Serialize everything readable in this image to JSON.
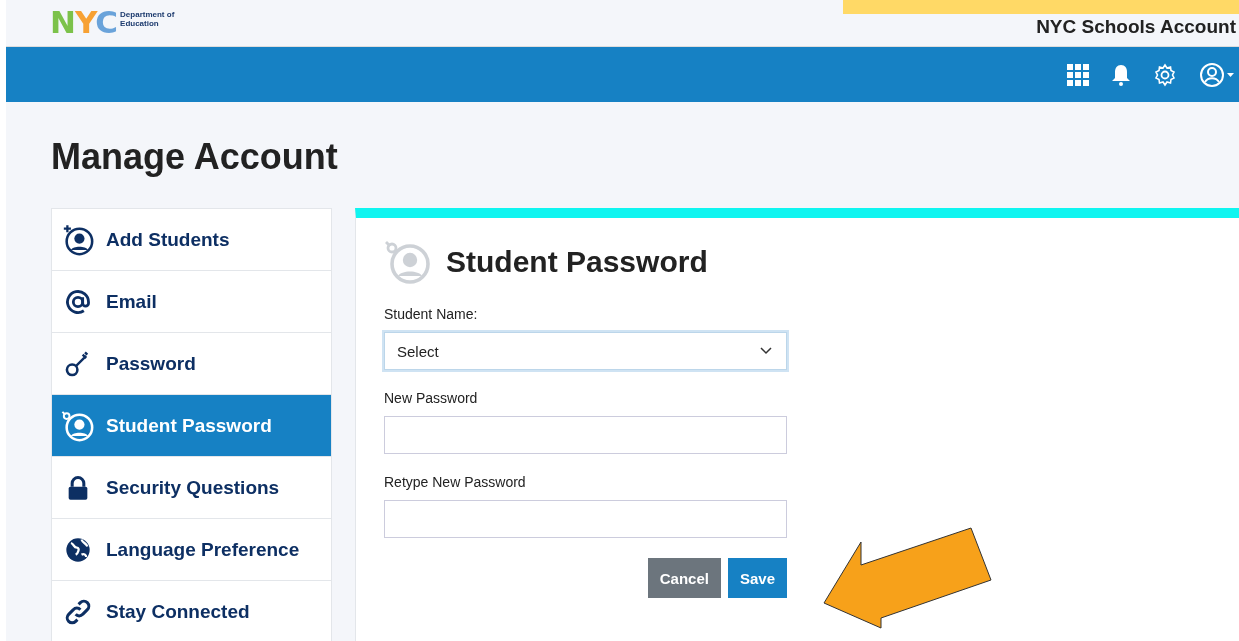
{
  "header": {
    "logo": {
      "letters": "NYC",
      "department": "Department of",
      "subline": "Education"
    },
    "account_title": "NYC Schools Account"
  },
  "page_title": "Manage Account",
  "sidebar": {
    "items": [
      {
        "label": "Add Students",
        "selected": false
      },
      {
        "label": "Email",
        "selected": false
      },
      {
        "label": "Password",
        "selected": false
      },
      {
        "label": "Student Password",
        "selected": true
      },
      {
        "label": "Security Questions",
        "selected": false
      },
      {
        "label": "Language Preference",
        "selected": false
      },
      {
        "label": "Stay Connected",
        "selected": false
      }
    ]
  },
  "panel": {
    "title": "Student Password",
    "fields": [
      {
        "kind": "select",
        "label": "Student Name:",
        "value": "Select"
      },
      {
        "kind": "password",
        "label": "New Password"
      },
      {
        "kind": "password",
        "label": "Retype New Password"
      }
    ],
    "buttons": [
      {
        "label": "Cancel",
        "kind": "secondary"
      },
      {
        "label": "Save",
        "kind": "primary"
      }
    ]
  }
}
